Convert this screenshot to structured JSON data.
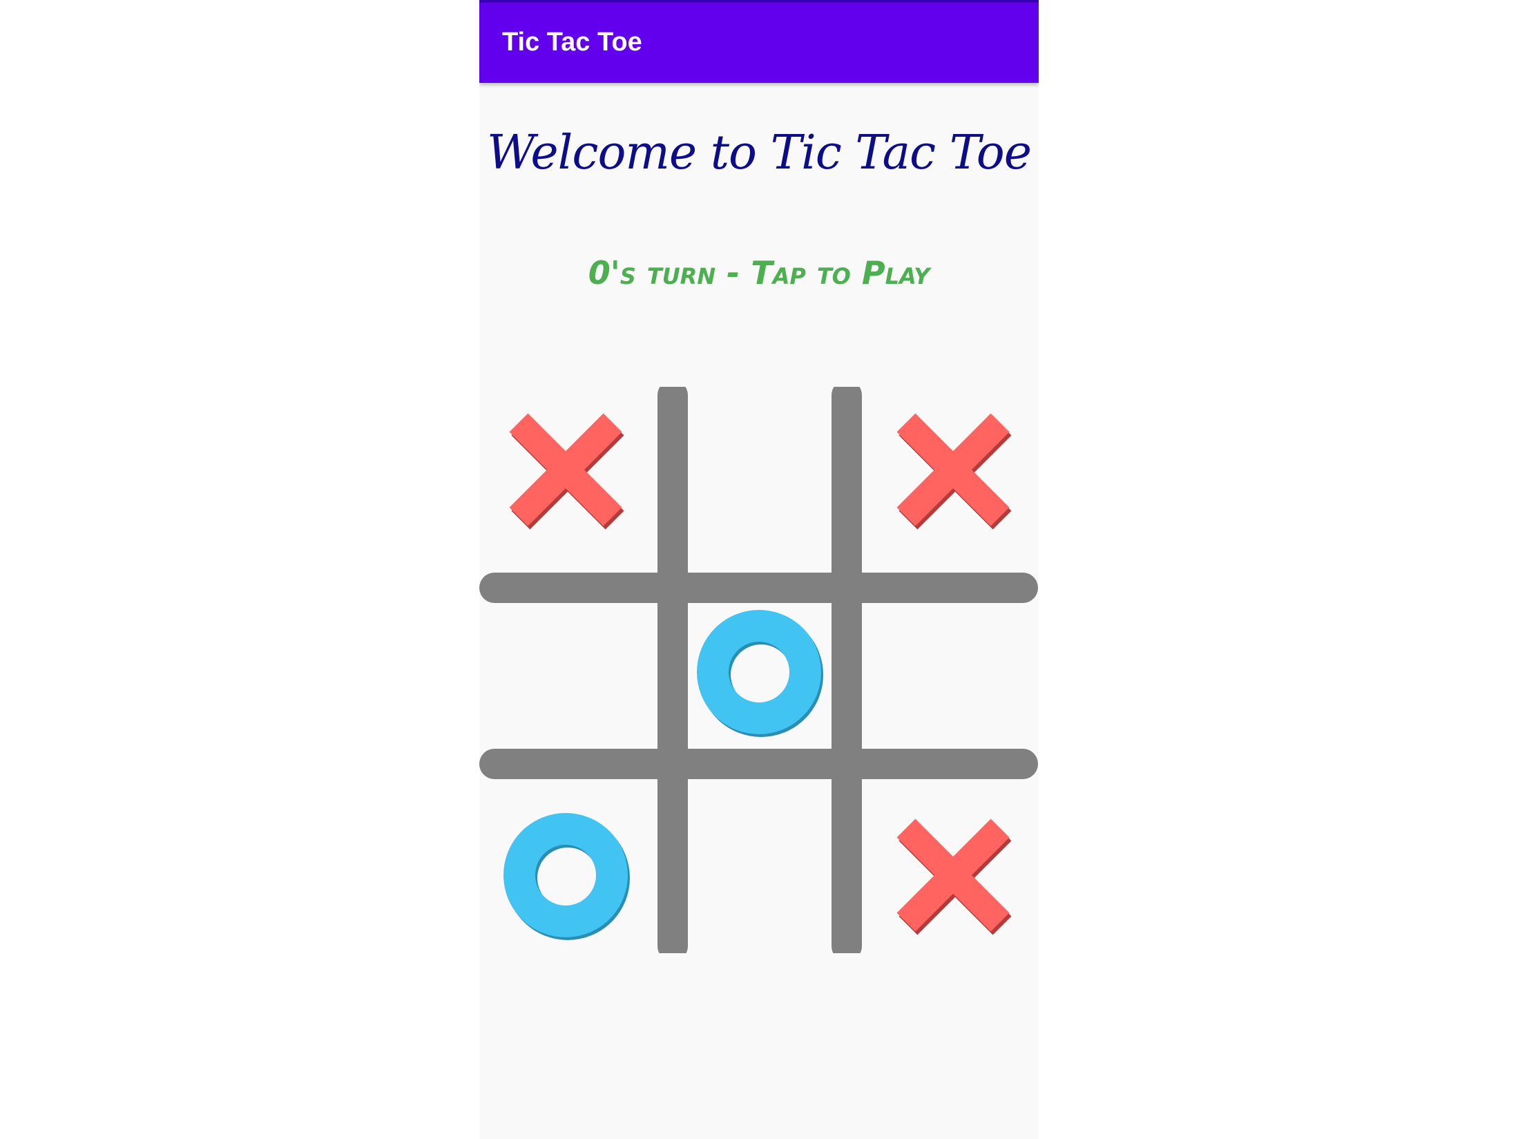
{
  "app_bar": {
    "title": "Tic Tac Toe",
    "color": "#6200ee"
  },
  "welcome_text": "Welcome to Tic Tac Toe",
  "status_text": "0's turn - Tap to Play",
  "colors": {
    "x_mark": "#ff6461",
    "o_mark": "#41c4f2",
    "grid": "#808080",
    "welcome": "#0d0d8a",
    "status": "#4caf50"
  },
  "board": {
    "cells": [
      "X",
      "",
      "X",
      "",
      "O",
      "",
      "O",
      "",
      "X"
    ]
  }
}
